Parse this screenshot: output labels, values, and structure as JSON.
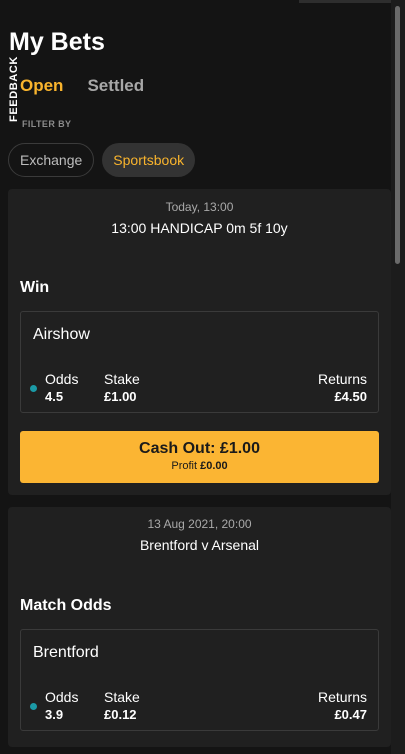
{
  "feedback_tab": "FEEDBACK",
  "page_title": "My Bets",
  "tabs": [
    {
      "label": "Open",
      "active": true
    },
    {
      "label": "Settled",
      "active": false
    }
  ],
  "filter_label": "FILTER BY",
  "filters": [
    {
      "label": "Exchange",
      "active": false
    },
    {
      "label": "Sportsbook",
      "active": true
    }
  ],
  "colors": {
    "accent": "#f9b42d",
    "background": "#141414",
    "card": "#202020",
    "status_dot": "#1b9aa6"
  },
  "bets": [
    {
      "datetime": "Today, 13:00",
      "event": "13:00 HANDICAP 0m 5f 10y",
      "market": "Win",
      "selection": "Airshow",
      "odds_label": "Odds",
      "odds": "4.5",
      "stake_label": "Stake",
      "stake": "£1.00",
      "returns_label": "Returns",
      "returns": "£4.50",
      "cashout_label": "Cash Out: £1.00",
      "profit_label": "Profit",
      "profit": "£0.00"
    },
    {
      "datetime": "13 Aug 2021, 20:00",
      "event": "Brentford v Arsenal",
      "market": "Match Odds",
      "selection": "Brentford",
      "odds_label": "Odds",
      "odds": "3.9",
      "stake_label": "Stake",
      "stake": "£0.12",
      "returns_label": "Returns",
      "returns": "£0.47"
    }
  ]
}
